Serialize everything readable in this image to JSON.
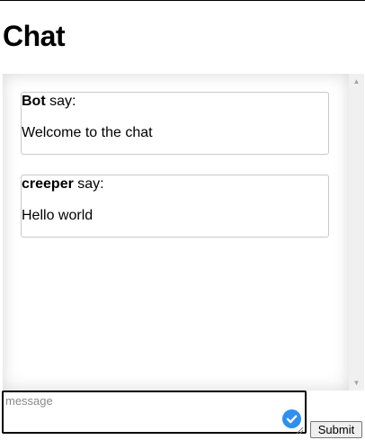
{
  "page": {
    "title": "Chat"
  },
  "messages": [
    {
      "sender": "Bot",
      "verb": " say:",
      "text": "Welcome to the chat"
    },
    {
      "sender": "creeper",
      "verb": " say:",
      "text": "Hello world"
    }
  ],
  "composer": {
    "placeholder": "message",
    "value": "",
    "status_icon": "check-circle-icon",
    "accent_color": "#2f8ff0"
  },
  "actions": {
    "submit_label": "Submit"
  }
}
